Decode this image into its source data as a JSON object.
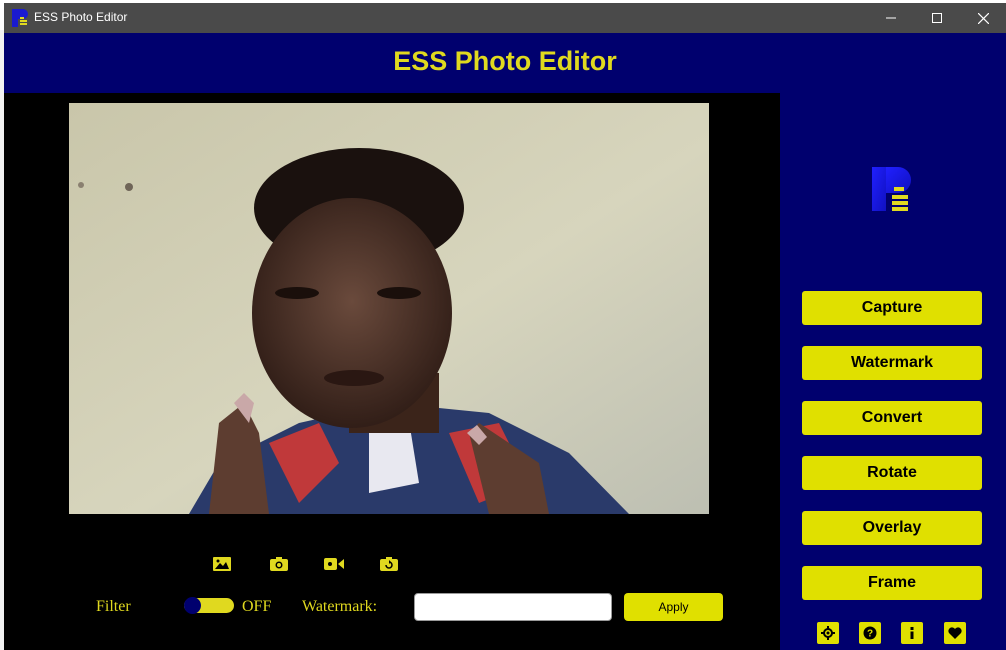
{
  "window": {
    "title": "ESS Photo Editor"
  },
  "header": {
    "title": "ESS Photo Editor"
  },
  "controls": {
    "filter_label": "Filter",
    "filter_state": "OFF",
    "filter_on": false,
    "watermark_label": "Watermark:",
    "watermark_value": "",
    "apply_label": "Apply"
  },
  "toolbar_icons": [
    "image-icon",
    "camera-icon",
    "video-camera-icon",
    "rotate-camera-icon"
  ],
  "sidebar": {
    "buttons": [
      "Capture",
      "Watermark",
      "Convert",
      "Rotate",
      "Overlay",
      "Frame"
    ],
    "bottom_icons": [
      "settings-icon",
      "help-icon",
      "info-icon",
      "heart-icon"
    ]
  },
  "colors": {
    "background": "#00006e",
    "accent": "#e0d91f",
    "button": "#e0e000",
    "titlebar": "#4a4a4a",
    "panel": "#000000"
  }
}
